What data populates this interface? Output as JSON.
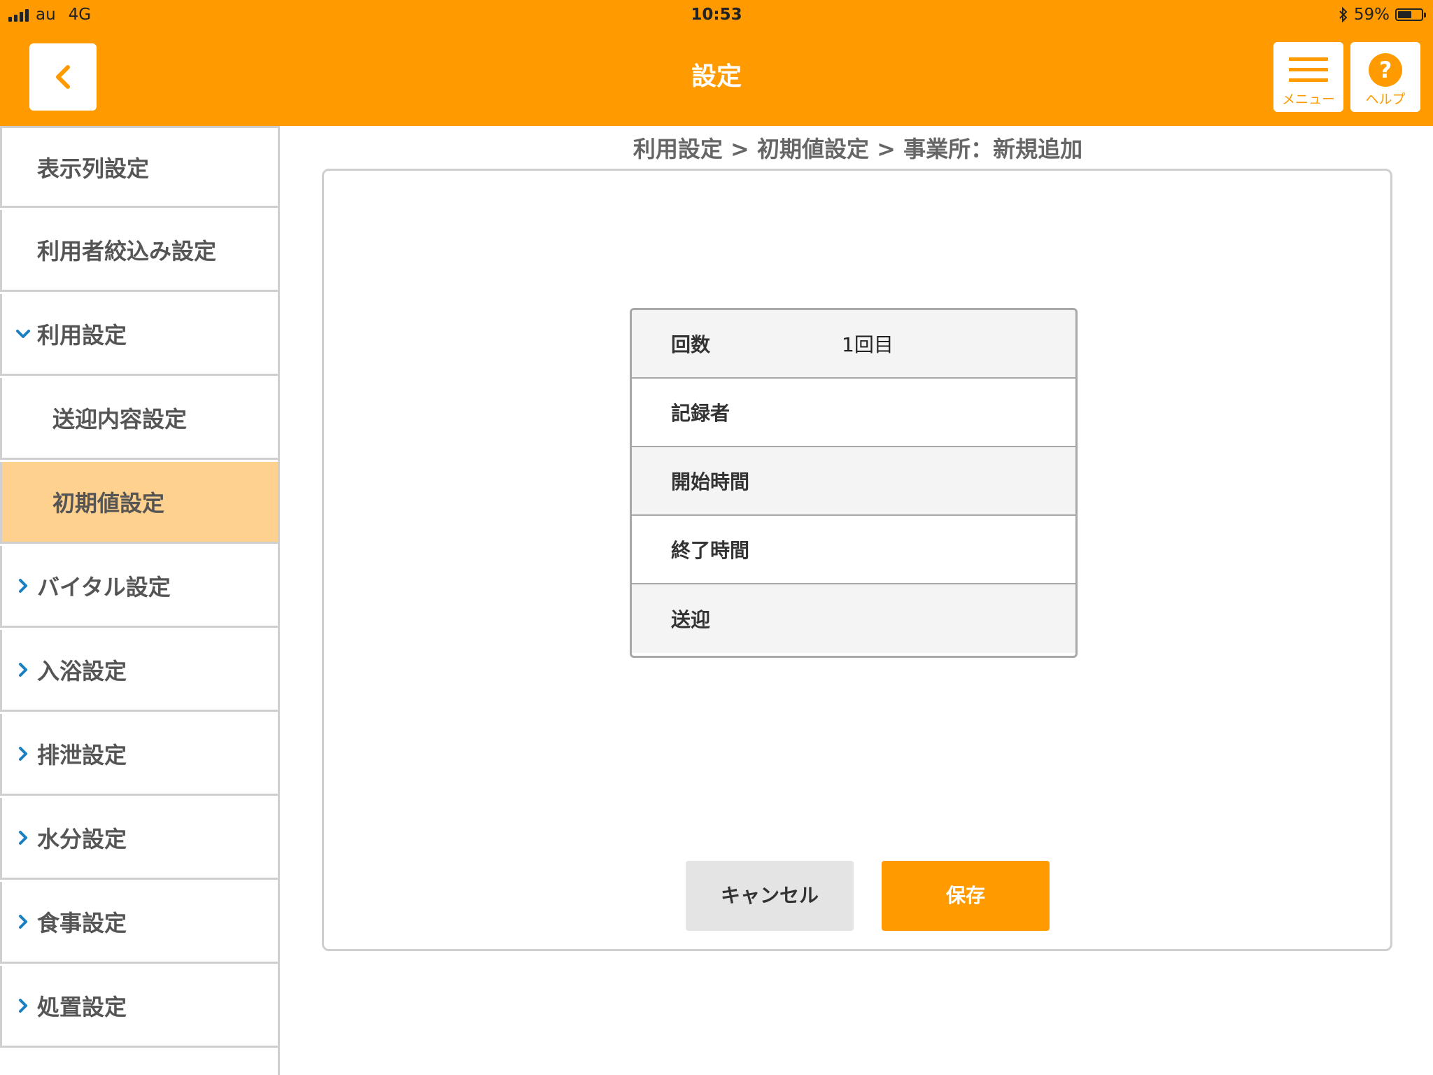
{
  "status_bar": {
    "carrier": "au",
    "network": "4G",
    "time": "10:53",
    "battery": "59%",
    "battery_level": 0.59
  },
  "header": {
    "title": "設定",
    "menu_label": "メニュー",
    "help_label": "ヘルプ",
    "help_glyph": "?"
  },
  "colors": {
    "accent": "#ff9a00",
    "active_item": "#ffd18f",
    "chevron": "#1a7fc1"
  },
  "sidebar": {
    "items": [
      {
        "label": "表示列設定",
        "icon": "none"
      },
      {
        "label": "利用者絞込み設定",
        "icon": "none"
      },
      {
        "label": "利用設定",
        "icon": "chevron-down-icon"
      },
      {
        "label": "送迎内容設定",
        "icon": "none",
        "sub": true
      },
      {
        "label": "初期値設定",
        "icon": "none",
        "sub": true,
        "selected": true
      },
      {
        "label": "バイタル設定",
        "icon": "chevron-right-icon"
      },
      {
        "label": "入浴設定",
        "icon": "chevron-right-icon"
      },
      {
        "label": "排泄設定",
        "icon": "chevron-right-icon"
      },
      {
        "label": "水分設定",
        "icon": "chevron-right-icon"
      },
      {
        "label": "食事設定",
        "icon": "chevron-right-icon"
      },
      {
        "label": "処置設定",
        "icon": "chevron-right-icon"
      }
    ]
  },
  "breadcrumb": "利用設定 > 初期値設定 > 事業所：新規追加",
  "form": {
    "rows": [
      {
        "label": "回数",
        "value": "1回目"
      },
      {
        "label": "記録者",
        "value": ""
      },
      {
        "label": "開始時間",
        "value": ""
      },
      {
        "label": "終了時間",
        "value": ""
      },
      {
        "label": "送迎",
        "value": ""
      }
    ]
  },
  "buttons": {
    "cancel": "キャンセル",
    "save": "保存"
  }
}
